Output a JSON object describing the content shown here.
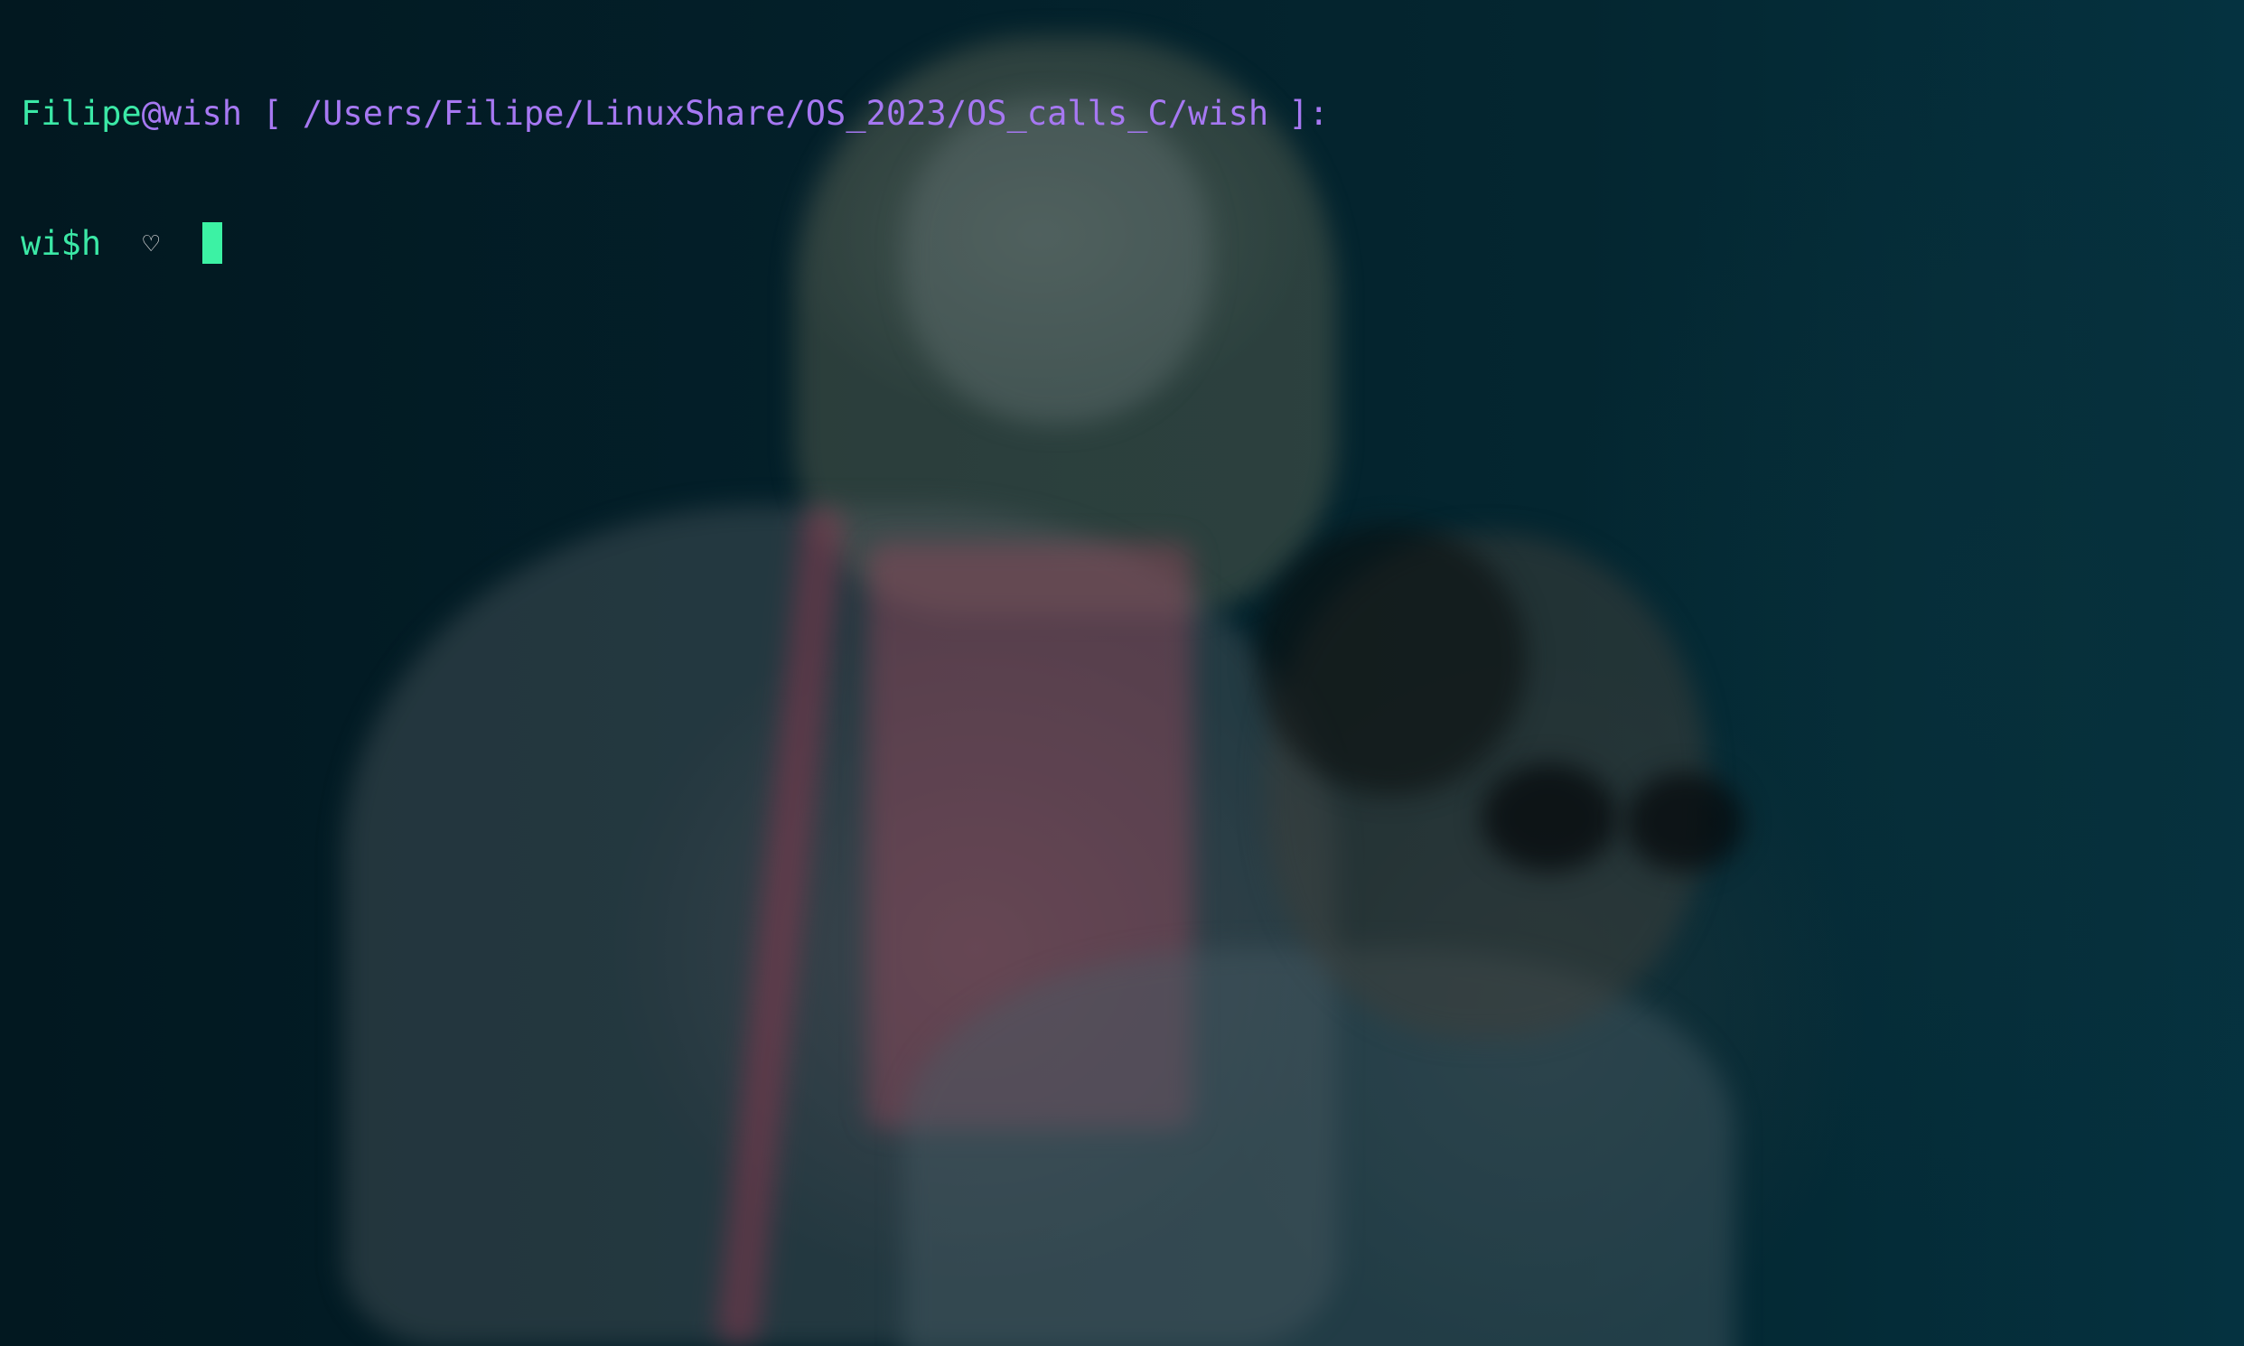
{
  "terminal": {
    "background_style": "dark teal wallpaper photo of two people",
    "colors": {
      "user": "#3be8a6",
      "path": "#a678f2",
      "prompt": "#3be8a6",
      "cursor": "#3cf2a4"
    },
    "header": {
      "user": "Filipe",
      "at_host": "@wish",
      "path_segment": " [ /Users/Filipe/LinuxShare/OS_2023/OS_calls_C/wish ]:"
    },
    "prompt": {
      "text": "wi$h",
      "symbol": "♡",
      "symbol_icon": "heart-icon",
      "input_value": ""
    }
  }
}
